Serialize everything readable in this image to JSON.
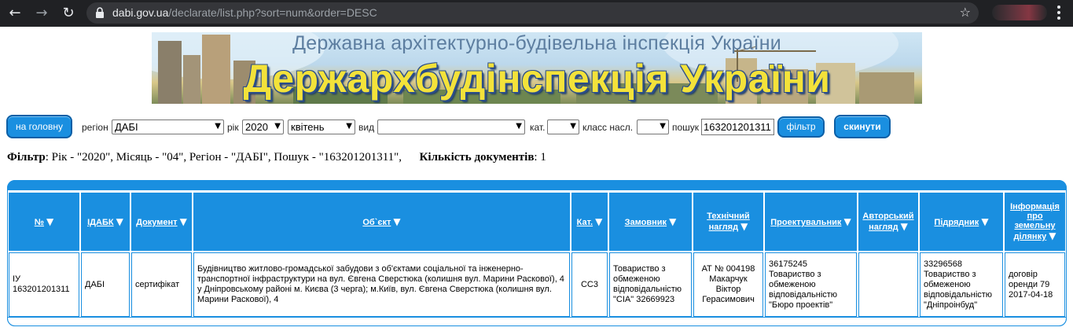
{
  "browser": {
    "url_domain": "dabi.gov.ua",
    "url_path": "/declarate/list.php?sort=num&order=DESC"
  },
  "banner": {
    "subtitle": "Державна архітектурно-будівельна інспекція України",
    "title": "Держархбудінспекція України"
  },
  "filters": {
    "home_button": "на головну",
    "region_label": "регіон",
    "region_value": "ДАБІ",
    "year_label": "рік",
    "year_value": "2020",
    "month_value": "квітень",
    "type_label": "вид",
    "type_value": "",
    "category_label": "кат.",
    "category_value": "",
    "class_label": "класс насл.",
    "class_value": "",
    "search_label": "пошук",
    "search_value": "163201201311",
    "filter_button": "фільтр",
    "reset_button": "скинути"
  },
  "filter_summary": {
    "filter_word": "Фільтр",
    "filter_text": ": Рік - \"2020\", Місяць - \"04\", Регіон - \"ДАБІ\", Пошук - \"163201201311\",",
    "count_word": "Кількість документів",
    "count_value": ": 1"
  },
  "table": {
    "columns": [
      {
        "label": "№",
        "arrow": "▼"
      },
      {
        "label": "ІДАБК",
        "arrow": "▼"
      },
      {
        "label": "Документ",
        "arrow": "▼"
      },
      {
        "label": "Об`єкт",
        "arrow": "▼"
      },
      {
        "label": "Кат.",
        "arrow": "▼"
      },
      {
        "label": "Замовник",
        "arrow": "▼"
      },
      {
        "label": "Технічний нагляд",
        "arrow": "▼"
      },
      {
        "label": "Проектувальник",
        "arrow": "▼"
      },
      {
        "label": "Авторський нагляд",
        "arrow": "▼"
      },
      {
        "label": "Підрядник",
        "arrow": "▼"
      },
      {
        "label": "Інформація про земельну ділянку",
        "arrow": "▼"
      }
    ],
    "rows": [
      {
        "num": "ІУ 163201201311",
        "idabk": "ДАБІ",
        "document": "сертифікат",
        "object": "Будівництво житлово-громадської забудови з об'єктами соціальної та інженерно-транспортної інфраструктури на вул. Євгена Сверстюка (колишня вул. Марини Раскової), 4 у Дніпровському районі м. Києва (3 черга); м.Київ, вул. Євгена Сверстюка (колишня вул. Марини Раскової), 4",
        "category": "СС3",
        "customer": "Товариство з обмеженою відповідальністю \"СІА\" 32669923",
        "tech_supervision": "АТ № 004198 Макарчук Віктор Герасимович",
        "designer": "36175245 Товариство з обмеженою відповідальністю \"Бюро проектів\"",
        "author_supervision": "",
        "contractor": "33296568 Товариство з обмеженою відповідальністю \"Дніпроінбуд\"",
        "land_info": "договір оренди 79 2017-04-18"
      }
    ]
  },
  "colors": {
    "accent": "#1a8fe0",
    "chrome": "#202124"
  }
}
